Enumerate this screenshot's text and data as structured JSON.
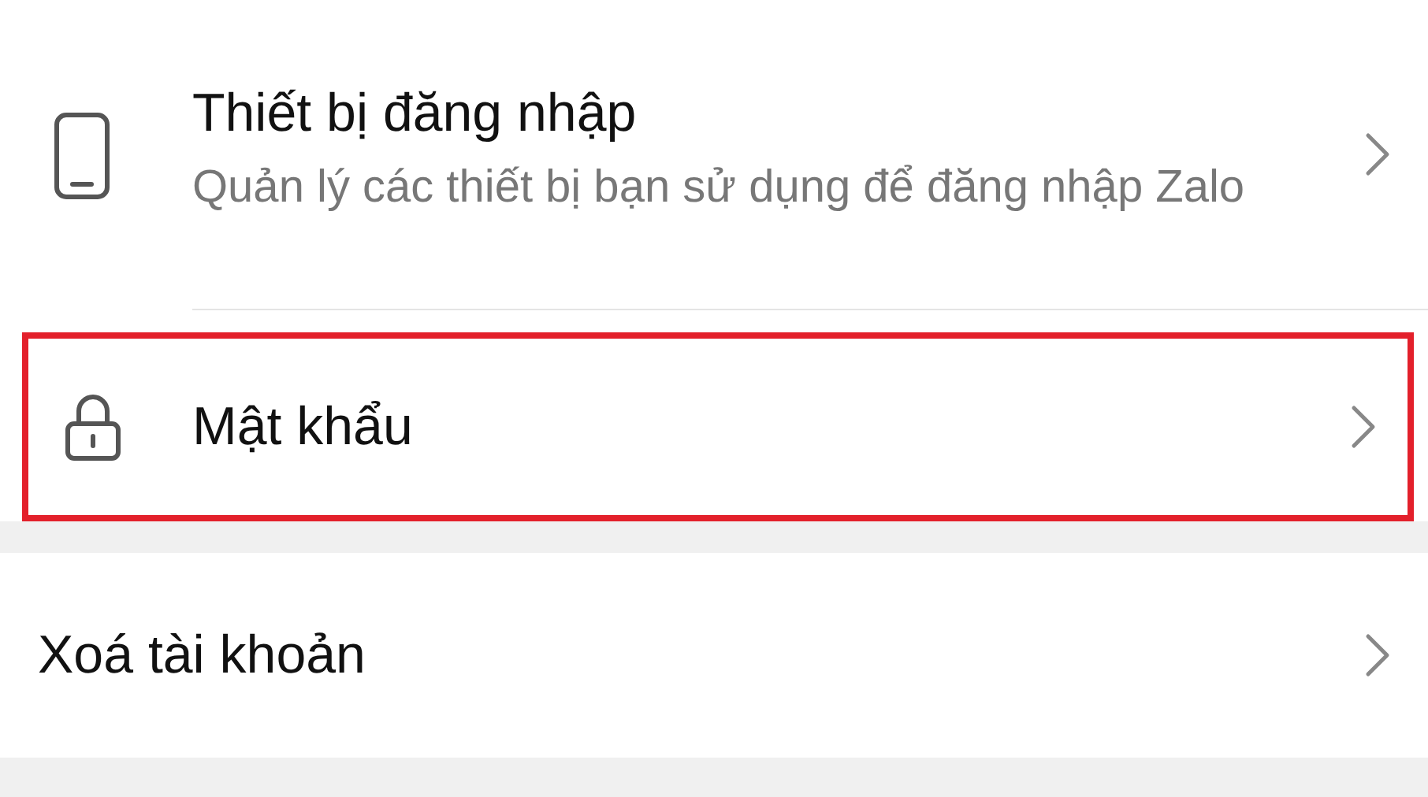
{
  "sections": [
    {
      "items": [
        {
          "kind": "device",
          "title": "Thiết bị đăng nhập",
          "subtitle": "Quản lý các thiết bị bạn sử dụng để đăng nhập Zalo",
          "highlighted": false
        },
        {
          "kind": "lock",
          "title": "Mật khẩu",
          "highlighted": true
        }
      ]
    },
    {
      "items": [
        {
          "kind": "plain",
          "title": "Xoá tài khoản",
          "highlighted": false
        }
      ]
    }
  ]
}
